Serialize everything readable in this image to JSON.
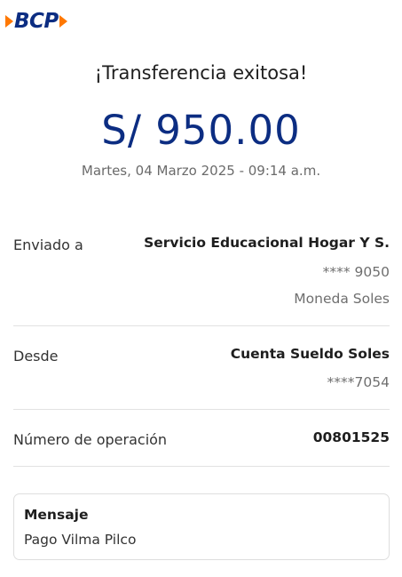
{
  "brand": {
    "logo_text": "BCP",
    "colors": {
      "primary": "#0c2d82",
      "accent": "#ff7800"
    }
  },
  "receipt": {
    "title": "¡Transferencia exitosa!",
    "amount": "S/ 950.00",
    "date": "Martes, 04 Marzo 2025 - 09:14 a.m."
  },
  "details": {
    "sent_to": {
      "label": "Enviado a",
      "name": "Servicio Educacional Hogar Y S.",
      "account": "**** 9050",
      "currency": "Moneda Soles"
    },
    "from": {
      "label": "Desde",
      "account_name": "Cuenta Sueldo Soles",
      "account": "****7054"
    },
    "operation": {
      "label": "Número de operación",
      "number": "00801525"
    }
  },
  "message": {
    "title": "Mensaje",
    "text": "Pago Vilma Pilco"
  }
}
